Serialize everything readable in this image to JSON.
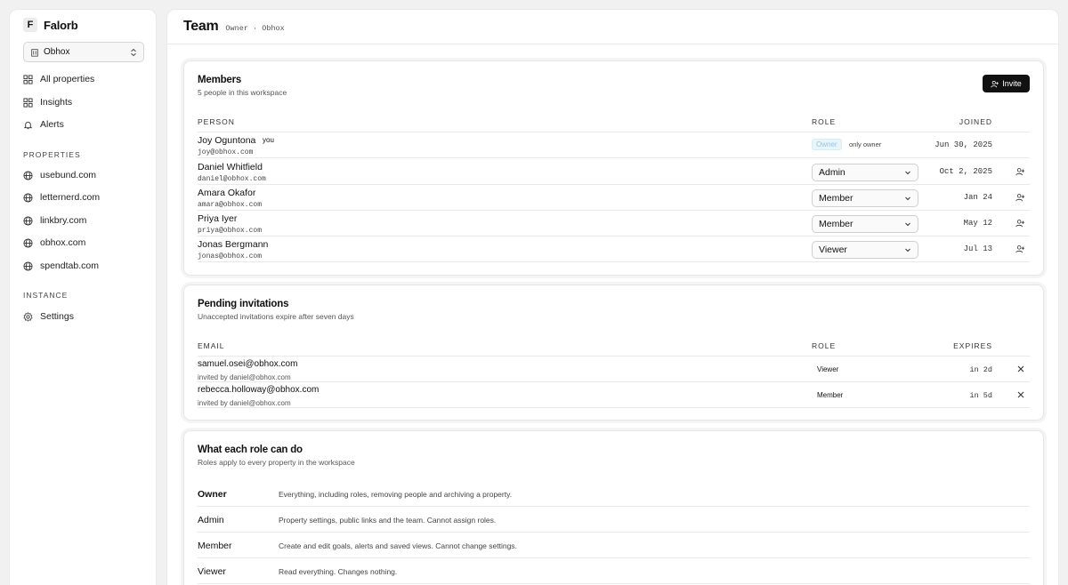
{
  "brand": {
    "logo": "F",
    "name": "Falorb"
  },
  "workspace": {
    "selected": "Obhox"
  },
  "nav": [
    {
      "label": "All properties",
      "icon": "grid-icon"
    },
    {
      "label": "Insights",
      "icon": "grid-icon"
    },
    {
      "label": "Alerts",
      "icon": "bell-icon"
    }
  ],
  "properties": {
    "label": "PROPERTIES",
    "items": [
      "usebund.com",
      "letternerd.com",
      "linkbry.com",
      "obhox.com",
      "spendtab.com"
    ]
  },
  "instance": {
    "label": "INSTANCE",
    "settings": "Settings"
  },
  "header": {
    "title": "Team",
    "crumb": "Owner · Obhox"
  },
  "members": {
    "title": "Members",
    "subtitle": "5 people in this workspace",
    "invite_label": "Invite",
    "columns": {
      "person": "PERSON",
      "role": "ROLE",
      "joined": "JOINED"
    },
    "rows": [
      {
        "name": "Joy Oguntona",
        "email": "joy@obhox.com",
        "you": "you",
        "role": "Owner",
        "note": "only owner",
        "joined": "Jun 30, 2025"
      },
      {
        "name": "Daniel Whitfield",
        "email": "daniel@obhox.com",
        "role": "Admin",
        "joined": "Oct 2, 2025"
      },
      {
        "name": "Amara Okafor",
        "email": "amara@obhox.com",
        "role": "Member",
        "joined": "Jan 24"
      },
      {
        "name": "Priya Iyer",
        "email": "priya@obhox.com",
        "role": "Member",
        "joined": "May 12"
      },
      {
        "name": "Jonas Bergmann",
        "email": "jonas@obhox.com",
        "role": "Viewer",
        "joined": "Jul 13"
      }
    ]
  },
  "pending": {
    "title": "Pending invitations",
    "subtitle": "Unaccepted invitations expire after seven days",
    "columns": {
      "email": "EMAIL",
      "role": "ROLE",
      "expires": "EXPIRES"
    },
    "rows": [
      {
        "email": "samuel.osei@obhox.com",
        "by": "invited by daniel@obhox.com",
        "role": "Viewer",
        "expires": "in 2d"
      },
      {
        "email": "rebecca.holloway@obhox.com",
        "by": "invited by daniel@obhox.com",
        "role": "Member",
        "expires": "in 5d"
      }
    ]
  },
  "roles": {
    "title": "What each role can do",
    "subtitle": "Roles apply to every property in the workspace",
    "rows": [
      {
        "name": "Owner",
        "desc": "Everything, including roles, removing people and archiving a property."
      },
      {
        "name": "Admin",
        "desc": "Property settings, public links and the team. Cannot assign roles."
      },
      {
        "name": "Member",
        "desc": "Create and edit goals, alerts and saved views. Cannot change settings."
      },
      {
        "name": "Viewer",
        "desc": "Read everything. Changes nothing."
      }
    ]
  }
}
